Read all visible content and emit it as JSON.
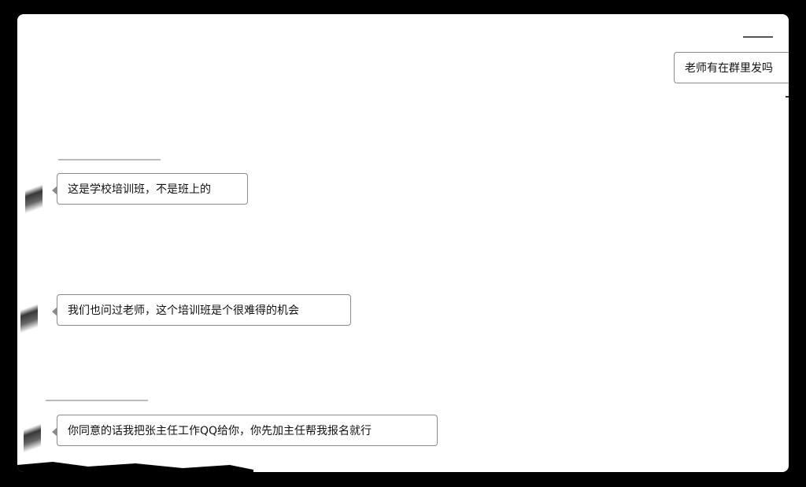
{
  "messages": [
    {
      "side": "right",
      "text": "老师有在群里发吗"
    },
    {
      "side": "left",
      "text": "这是学校培训班，不是班上的"
    },
    {
      "side": "left",
      "text": "我们也问过老师，这个培训班是个很难得的机会"
    },
    {
      "side": "left",
      "text": "你同意的话我把张主任工作QQ给你，你先加主任帮我报名就行"
    }
  ],
  "colors": {
    "background": "#000000",
    "chat_area": "#ffffff",
    "bubble_border": "#8a8a8a",
    "text": "#111111"
  }
}
